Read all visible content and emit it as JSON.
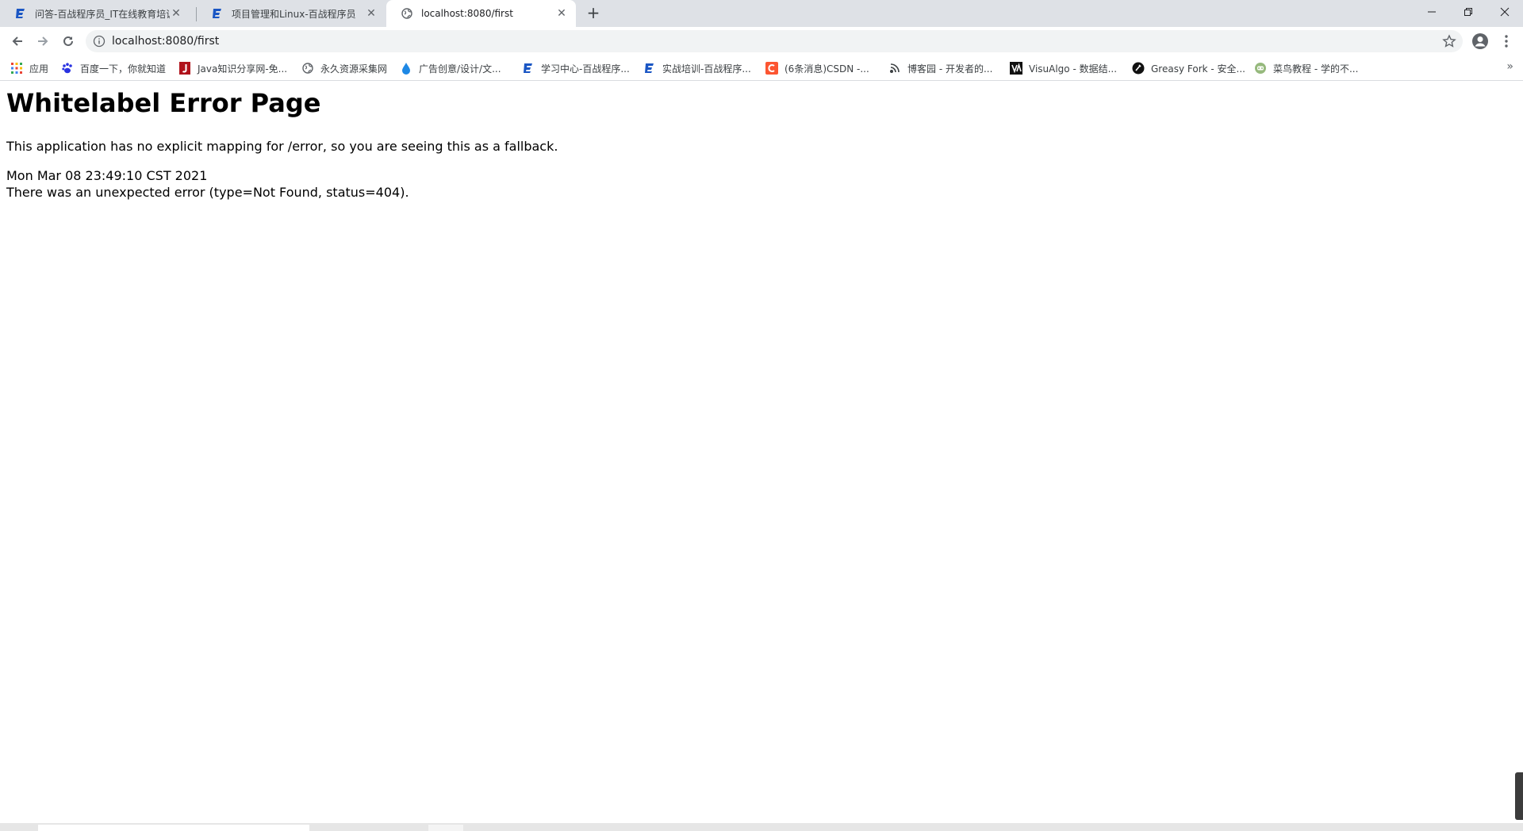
{
  "tabs": [
    {
      "title": "问答-百战程序员_IT在线教育培训",
      "favicon": "baizhan-icon",
      "active": false
    },
    {
      "title": "项目管理和Linux-百战程序员",
      "favicon": "baizhan-icon",
      "active": false
    },
    {
      "title": "localhost:8080/first",
      "favicon": "globe-icon",
      "active": true
    }
  ],
  "new_tab_label": "+",
  "close_glyph": "✕",
  "address_bar": {
    "url": "localhost:8080/first"
  },
  "bookmarks": [
    {
      "label": "应用",
      "icon": "apps-grid-icon"
    },
    {
      "label": "百度一下，你就知道",
      "icon": "baidu-paw-icon"
    },
    {
      "label": "Java知识分享网-免...",
      "icon": "java-j-icon"
    },
    {
      "label": "永久资源采集网",
      "icon": "globe-icon"
    },
    {
      "label": "广告创意/设计/文...",
      "icon": "drop-icon"
    },
    {
      "label": "学习中心-百战程序...",
      "icon": "baizhan-icon"
    },
    {
      "label": "实战培训-百战程序...",
      "icon": "baizhan-icon"
    },
    {
      "label": "(6条消息)CSDN -...",
      "icon": "csdn-c-icon"
    },
    {
      "label": "博客园 - 开发者的...",
      "icon": "cnblogs-icon"
    },
    {
      "label": "VisuAlgo - 数据结...",
      "icon": "visualgo-icon"
    },
    {
      "label": "Greasy Fork - 安全...",
      "icon": "greasyfork-icon"
    },
    {
      "label": "菜鸟教程 - 学的不...",
      "icon": "runoob-icon"
    }
  ],
  "bookmarks_overflow": "»",
  "page": {
    "heading": "Whitelabel Error Page",
    "fallback_text": "This application has no explicit mapping for /error, so you are seeing this as a fallback.",
    "timestamp": "Mon Mar 08 23:49:10 CST 2021",
    "error_text": "There was an unexpected error (type=Not Found, status=404)."
  },
  "colors": {
    "tabstrip": "#dee1e6",
    "baizhan_blue": "#1a56c4",
    "csdn_red": "#fc5531",
    "runoob_green": "#96b97d"
  }
}
